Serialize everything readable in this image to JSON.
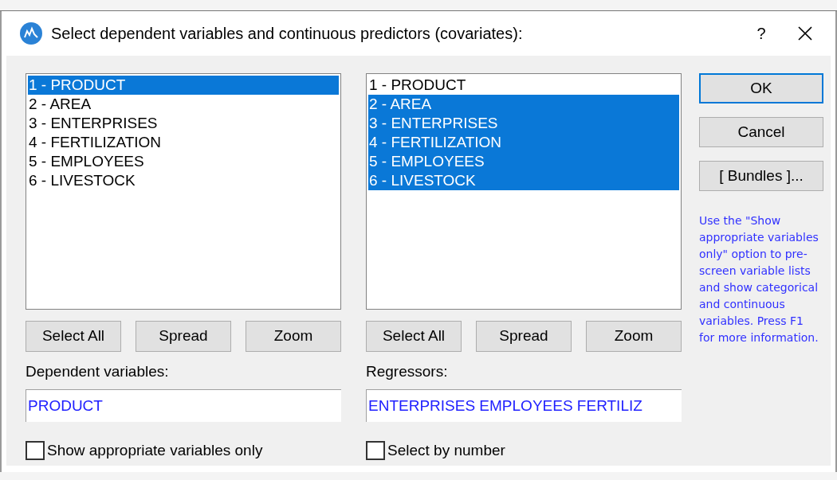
{
  "window": {
    "title": "Select dependent variables and continuous predictors (covariates):",
    "help_button": "?"
  },
  "panels": [
    {
      "items": [
        {
          "label": "1 - PRODUCT",
          "selected": true
        },
        {
          "label": "2 - AREA",
          "selected": false
        },
        {
          "label": "3 - ENTERPRISES",
          "selected": false
        },
        {
          "label": "4 - FERTILIZATION",
          "selected": false
        },
        {
          "label": "5 - EMPLOYEES",
          "selected": false
        },
        {
          "label": "6 - LIVESTOCK",
          "selected": false
        }
      ],
      "buttons": [
        "Select All",
        "Spread",
        "Zoom"
      ],
      "field_label": "Dependent variables:",
      "field_value": "PRODUCT",
      "checkbox": {
        "label": "Show appropriate variables only",
        "checked": false
      }
    },
    {
      "items": [
        {
          "label": "1 - PRODUCT",
          "selected": false
        },
        {
          "label": "2 - AREA",
          "selected": true
        },
        {
          "label": "3 - ENTERPRISES",
          "selected": true
        },
        {
          "label": "4 - FERTILIZATION",
          "selected": true
        },
        {
          "label": "5 - EMPLOYEES",
          "selected": true
        },
        {
          "label": "6 - LIVESTOCK",
          "selected": true
        }
      ],
      "buttons": [
        "Select All",
        "Spread",
        "Zoom"
      ],
      "field_label": "Regressors:",
      "field_value": "ENTERPRISES EMPLOYEES FERTILIZ",
      "checkbox": {
        "label": "Select by number",
        "checked": false
      }
    }
  ],
  "side_buttons": [
    {
      "label": "OK",
      "default": true
    },
    {
      "label": "Cancel",
      "default": false
    },
    {
      "label": "[ Bundles ]...",
      "default": false
    }
  ],
  "help_text": "Use the \"Show appropriate variables only\" option to pre-screen variable lists and show categorical and continuous variables. Press F1 for more information."
}
